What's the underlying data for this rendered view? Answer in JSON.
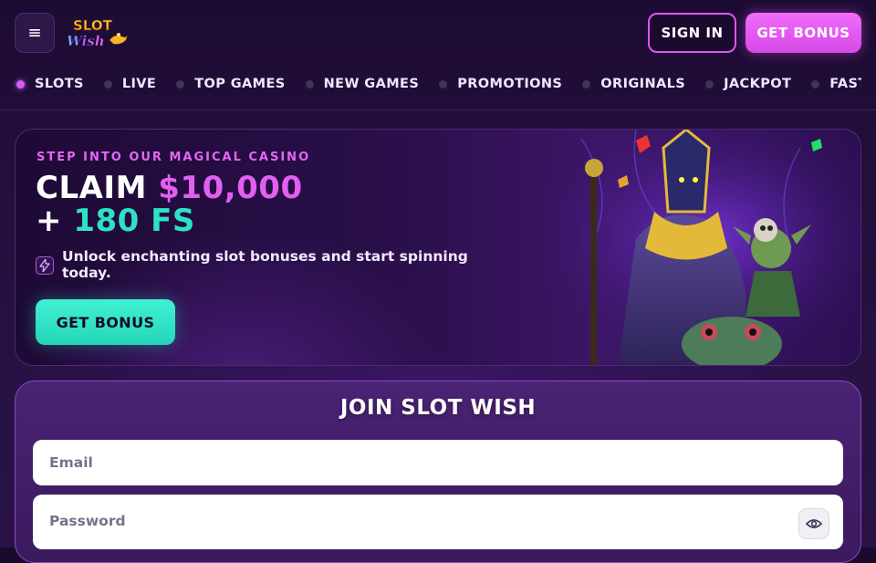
{
  "header": {
    "menu_icon": "hamburger-menu-icon",
    "logo_text": "SLOT WISH",
    "sign_in_label": "SIGN IN",
    "get_bonus_label": "GET BONUS"
  },
  "nav": {
    "items": [
      {
        "label": "SLOTS",
        "active": true
      },
      {
        "label": "LIVE",
        "active": false
      },
      {
        "label": "TOP GAMES",
        "active": false
      },
      {
        "label": "NEW GAMES",
        "active": false
      },
      {
        "label": "PROMOTIONS",
        "active": false
      },
      {
        "label": "ORIGINALS",
        "active": false
      },
      {
        "label": "JACKPOT",
        "active": false
      },
      {
        "label": "FAST GAMES",
        "active": false
      }
    ]
  },
  "hero": {
    "eyebrow": "STEP INTO OUR MAGICAL CASINO",
    "title_prefix": "CLAIM",
    "title_amount": "$10,000",
    "title_line2_prefix": "+",
    "title_fs": "180 FS",
    "description": "Unlock enchanting slot bonuses and start spinning today.",
    "cta_label": "GET BONUS",
    "icon": "lightning-bolt-icon"
  },
  "signup": {
    "title": "JOIN SLOT WISH",
    "email_placeholder": "Email",
    "password_placeholder": "Password",
    "toggle_icon": "eye-icon"
  },
  "colors": {
    "accent_pink": "#e25ff2",
    "accent_teal": "#2de2c4",
    "background": "#1a0a2e"
  }
}
